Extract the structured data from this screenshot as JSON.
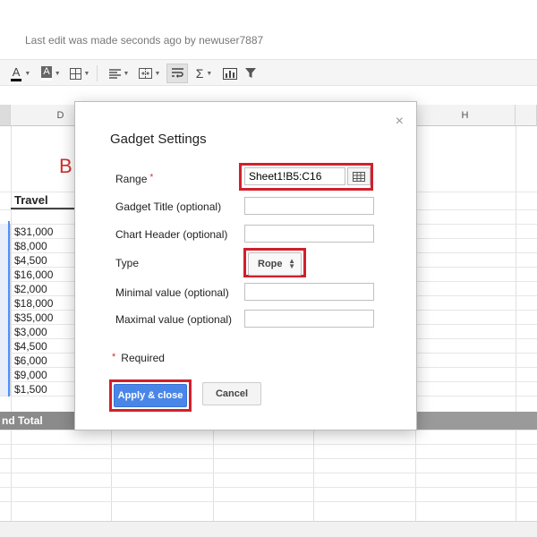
{
  "last_edit": "Last edit was made seconds ago by newuser7887",
  "toolbar": {
    "icons": [
      "text-color-icon",
      "fill-color-icon",
      "borders-icon",
      "align-icon",
      "merge-cells-icon",
      "wrap-text-icon",
      "functions-icon",
      "insert-chart-icon",
      "filter-icon"
    ],
    "text_color_glyph": "A",
    "fill_glyph": "A",
    "sigma_glyph": "Σ"
  },
  "sheet": {
    "col_d": "D",
    "col_h": "H",
    "title_fragment": "B",
    "travel_header": "Travel",
    "travel_values": [
      "$31,000",
      "$8,000",
      "$4,500",
      "$16,000",
      "$2,000",
      "$18,000",
      "$35,000",
      "$3,000",
      "$4,500",
      "$6,000",
      "$9,000",
      "$1,500"
    ],
    "grand_total_label": "nd Total"
  },
  "dialog": {
    "title": "Gadget Settings",
    "close_glyph": "×",
    "required_star": "*",
    "fields": {
      "range_label": "Range",
      "range_value": "Sheet1!B5:C16",
      "gadget_title_label": "Gadget Title (optional)",
      "gadget_title_value": "",
      "chart_header_label": "Chart Header (optional)",
      "chart_header_value": "",
      "type_label": "Type",
      "type_value": "Rope",
      "min_label": "Minimal value (optional)",
      "min_value": "",
      "max_label": "Maximal value (optional)",
      "max_value": ""
    },
    "required_note": "Required",
    "apply_label": "Apply & close",
    "cancel_label": "Cancel"
  },
  "colors": {
    "highlight": "#d0202c",
    "primary_button": "#4a86e8",
    "title_red": "#d32f2f"
  }
}
